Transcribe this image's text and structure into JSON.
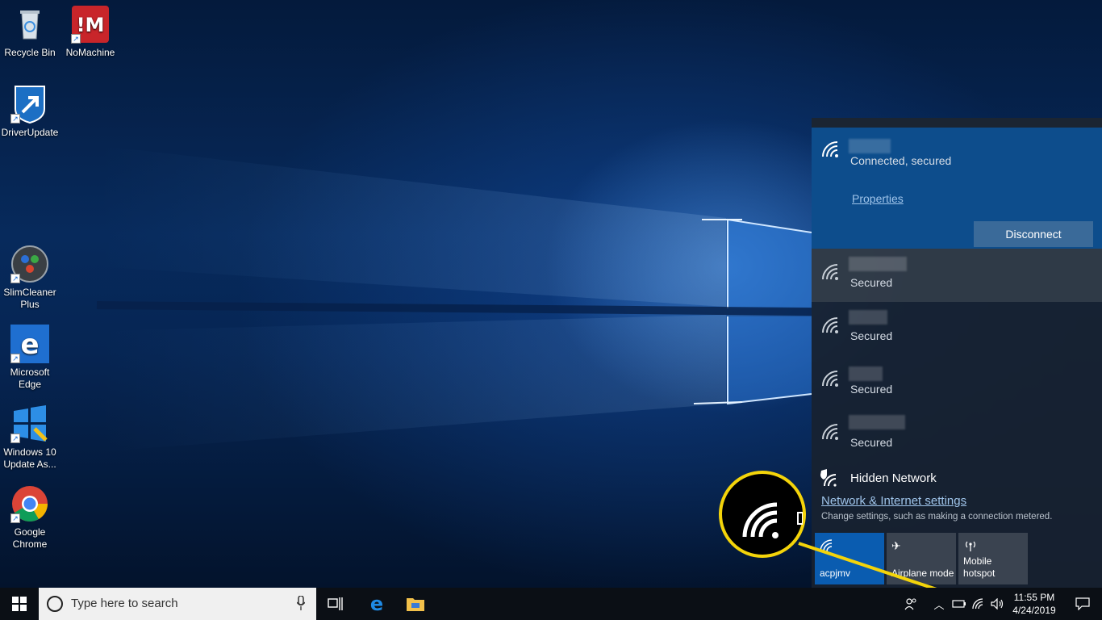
{
  "desktop_icons": [
    {
      "label_1": "Recycle Bin",
      "label_2": "",
      "icon": "recycle-bin-icon"
    },
    {
      "label_1": "NoMachine",
      "label_2": "",
      "icon": "nomachine-icon"
    },
    {
      "label_1": "DriverUpdate",
      "label_2": "",
      "icon": "driverupdate-icon"
    },
    {
      "label_1": "SlimCleaner",
      "label_2": "Plus",
      "icon": "slimcleaner-icon"
    },
    {
      "label_1": "Microsoft",
      "label_2": "Edge",
      "icon": "edge-icon"
    },
    {
      "label_1": "Windows 10",
      "label_2": "Update As...",
      "icon": "windows-update-icon"
    },
    {
      "label_1": "Google",
      "label_2": "Chrome",
      "icon": "chrome-icon"
    }
  ],
  "network_flyout": {
    "connected": {
      "status": "Connected, secured",
      "properties_label": "Properties",
      "disconnect_label": "Disconnect"
    },
    "networks": [
      {
        "status": "Secured"
      },
      {
        "status": "Secured"
      },
      {
        "status": "Secured"
      },
      {
        "status": "Secured"
      }
    ],
    "hidden_network_label": "Hidden Network",
    "settings_link": "Network & Internet settings",
    "settings_desc": "Change settings, such as making a connection metered.",
    "quick_tiles": [
      {
        "label": "acpjmv",
        "label_2": "",
        "active": true,
        "icon": "wifi-icon"
      },
      {
        "label": "Airplane mode",
        "label_2": "",
        "active": false,
        "icon": "airplane-icon"
      },
      {
        "label": "Mobile",
        "label_2": "hotspot",
        "active": false,
        "icon": "hotspot-icon"
      }
    ]
  },
  "taskbar": {
    "search_placeholder": "Type here to search",
    "clock_time": "11:55 PM",
    "clock_date": "4/24/2019"
  },
  "colors": {
    "accent": "#0a5cb0",
    "callout": "#f4d40a",
    "taskbar": "#0b0f15"
  }
}
